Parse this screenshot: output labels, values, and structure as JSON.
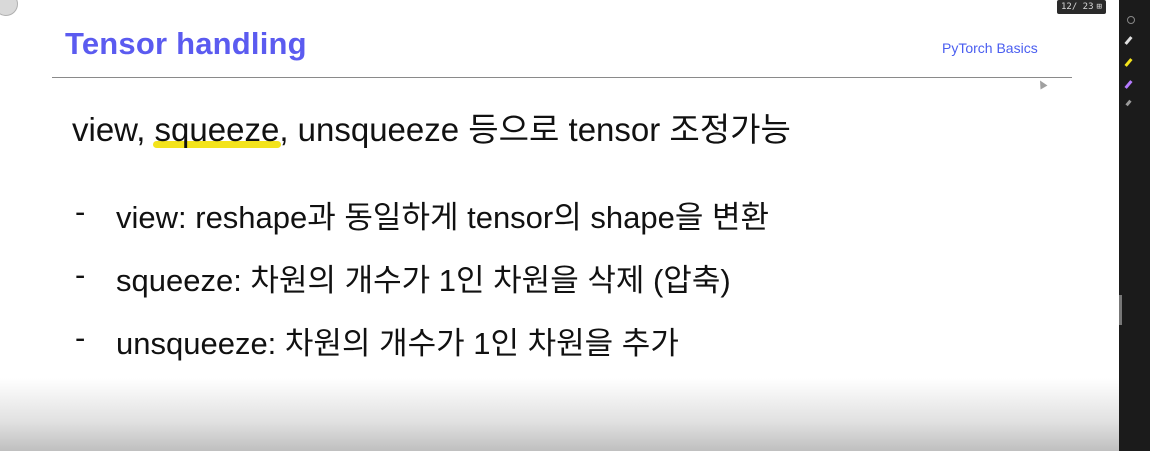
{
  "slide": {
    "title": "Tensor handling",
    "subtitle": "PyTorch Basics",
    "headline": {
      "before": "view, ",
      "highlighted": "squeeze",
      "after": ", unsqueeze 등으로 tensor 조정가능"
    },
    "bullets": [
      {
        "dash": "-",
        "text": "view: reshape과 동일하게 tensor의 shape을 변환"
      },
      {
        "dash": "-",
        "text": "squeeze: 차원의 개수가 1인 차원을 삭제 (압축)"
      },
      {
        "dash": "-",
        "text": "unsqueeze: 차원의 개수가 1인 차원을 추가"
      }
    ]
  },
  "viewer": {
    "page_counter": "12/ 23",
    "grid_icon": "grid-view-icon",
    "tools": [
      "lasso-icon",
      "pen-icon",
      "highlighter-icon",
      "marker-icon",
      "eraser-icon"
    ]
  },
  "colors": {
    "title": "#5b5bf0",
    "subtitle": "#4a5ef0",
    "highlight": "#f3e31c",
    "rail": "#1b1b1b"
  }
}
